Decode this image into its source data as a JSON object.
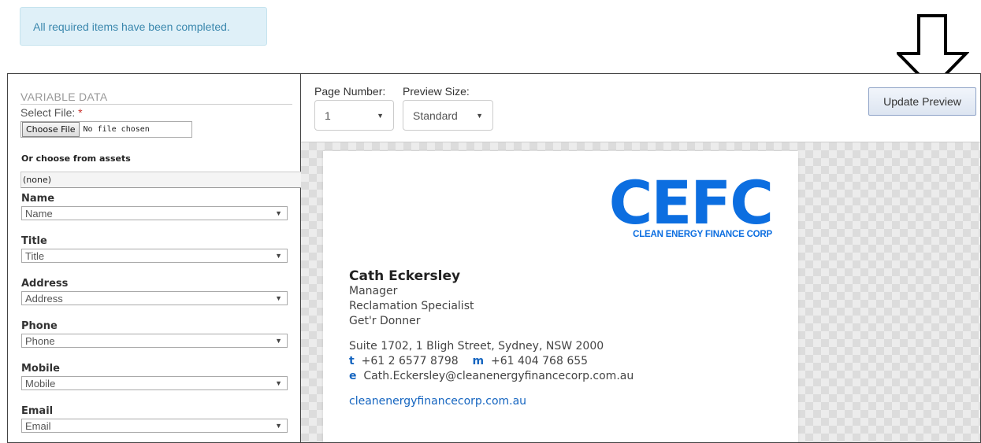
{
  "alert": {
    "message": "All required items have been completed."
  },
  "variable_data": {
    "section_title": "VARIABLE DATA",
    "select_file_label": "Select File:",
    "required_marker": "*",
    "choose_file_button": "Choose File",
    "file_status": "No file chosen",
    "assets_label": "Or choose from assets",
    "assets_selected": "(none)",
    "fields": [
      {
        "label": "Name",
        "value": "Name"
      },
      {
        "label": "Title",
        "value": "Title"
      },
      {
        "label": "Address",
        "value": "Address"
      },
      {
        "label": "Phone",
        "value": "Phone"
      },
      {
        "label": "Mobile",
        "value": "Mobile"
      },
      {
        "label": "Email",
        "value": "Email"
      }
    ]
  },
  "toolbar": {
    "page_number_label": "Page Number:",
    "page_number_value": "1",
    "preview_size_label": "Preview Size:",
    "preview_size_value": "Standard",
    "update_button": "Update Preview"
  },
  "card": {
    "logo_text": "CEFC",
    "logo_subtitle": "CLEAN ENERGY FINANCE CORP",
    "name": "Cath Eckersley",
    "title_lines": [
      "Manager",
      "Reclamation Specialist",
      "Get'r Donner"
    ],
    "address": "Suite 1702, 1 Bligh Street, Sydney, NSW 2000",
    "phone_label": "t",
    "phone": "+61 2 6577 8798",
    "mobile_label": "m",
    "mobile": "+61 404 768 655",
    "email_label": "e",
    "email": "Cath.Eckersley@cleanenergyfinancecorp.com.au",
    "website": "cleanenergyfinancecorp.com.au"
  },
  "colors": {
    "brand": "#0c6ee0",
    "alert_bg": "#dff0f8",
    "alert_text": "#3a87ad"
  }
}
